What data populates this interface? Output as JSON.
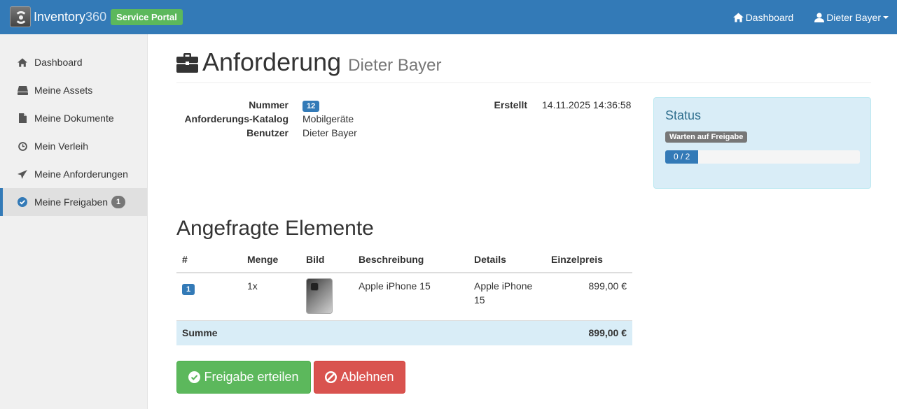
{
  "navbar": {
    "brand_name": "Inventory",
    "brand_num": "360",
    "portal_badge": "Service Portal",
    "dashboard_link": "Dashboard",
    "user_name": "Dieter Bayer"
  },
  "sidebar": {
    "items": [
      {
        "label": "Dashboard",
        "icon": "home-icon"
      },
      {
        "label": "Meine Assets",
        "icon": "drive-icon"
      },
      {
        "label": "Meine Dokumente",
        "icon": "document-icon"
      },
      {
        "label": "Mein Verleih",
        "icon": "clock-icon"
      },
      {
        "label": "Meine Anforderungen",
        "icon": "send-icon"
      },
      {
        "label": "Meine Freigaben",
        "icon": "check-circle-icon",
        "badge": "1",
        "active": true
      }
    ]
  },
  "header": {
    "title": "Anforderung",
    "subtitle": "Dieter Bayer"
  },
  "info": {
    "nummer_label": "Nummer",
    "nummer_value": "12",
    "katalog_label": "Anforderungs-Katalog",
    "katalog_value": "Mobilgeräte",
    "benutzer_label": "Benutzer",
    "benutzer_value": "Dieter Bayer",
    "erstellt_label": "Erstellt",
    "erstellt_value": "14.11.2025 14:36:58"
  },
  "status": {
    "title": "Status",
    "label": "Warten auf Freigabe",
    "progress_text": "0 / 2",
    "progress_fraction": 0.17
  },
  "items_section": {
    "title": "Angefragte Elemente",
    "columns": [
      "#",
      "Menge",
      "Bild",
      "Beschreibung",
      "Details",
      "Einzelpreis"
    ],
    "rows": [
      {
        "num": "1",
        "menge": "1x",
        "beschreibung": "Apple iPhone 15",
        "details": "Apple iPhone 15",
        "preis": "899,00 €"
      }
    ],
    "sum_label": "Summe",
    "sum_value": "899,00 €"
  },
  "actions": {
    "approve": "Freigabe erteilen",
    "reject": "Ablehnen"
  },
  "colors": {
    "primary": "#337ab7",
    "success": "#5cb85c",
    "danger": "#d9534f",
    "info_bg": "#d9edf7"
  }
}
